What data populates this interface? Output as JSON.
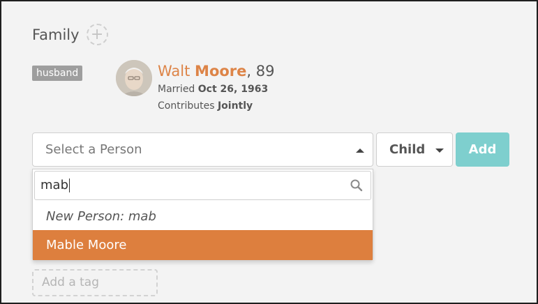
{
  "family": {
    "title": "Family",
    "add_icon_glyph": "+",
    "relation_tag": "husband",
    "person": {
      "first_name": "Walt",
      "last_name": "Moore",
      "age_suffix": ", 89",
      "married_label": "Married",
      "married_date": "Oct 26, 1963",
      "contributes_label": "Contributes",
      "contributes_value": "Jointly"
    }
  },
  "add_member": {
    "person_placeholder": "Select a Person",
    "relationship_value": "Child",
    "add_label": "Add"
  },
  "dropdown": {
    "search_value": "mab",
    "options": [
      {
        "label": "New Person: mab",
        "type": "new"
      },
      {
        "label": "Mable Moore",
        "type": "existing",
        "highlighted": true
      }
    ]
  },
  "tags": {
    "add_tag_placeholder": "Add a tag"
  },
  "colors": {
    "accent_orange": "#dd7f3e",
    "name_orange": "#dd8447",
    "add_button_teal": "#7ecfce",
    "tag_gray": "#9e9e9e"
  }
}
